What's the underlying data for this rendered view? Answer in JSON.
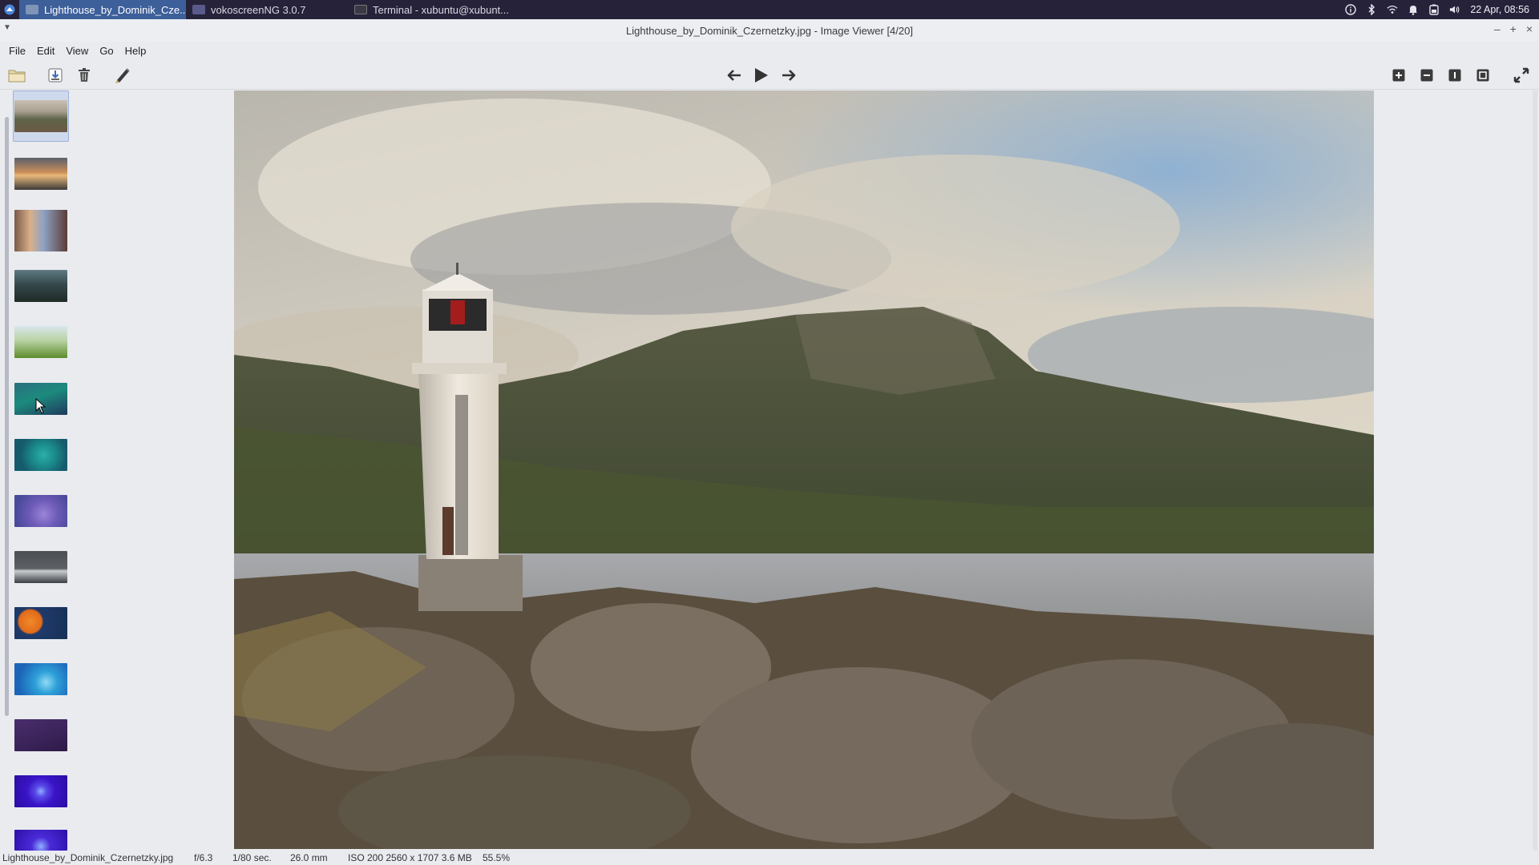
{
  "taskbar": {
    "tasks": [
      {
        "label": "Lighthouse_by_Dominik_Cze...",
        "active": true
      },
      {
        "label": "vokoscreenNG 3.0.7",
        "active": false
      },
      {
        "label": "Terminal - xubuntu@xubunt...",
        "active": false
      }
    ],
    "clock": "22 Apr, 08:56",
    "tray_icons": [
      "info-icon",
      "bluetooth-icon",
      "wifi-icon",
      "bell-icon",
      "battery-icon",
      "volume-icon"
    ]
  },
  "window": {
    "title": "Lighthouse_by_Dominik_Czernetzky.jpg - Image Viewer [4/20]"
  },
  "menubar": {
    "items": [
      "File",
      "Edit",
      "View",
      "Go",
      "Help"
    ]
  },
  "toolbar": {
    "left_icons": [
      "folder-open-icon",
      "save-icon",
      "delete-icon",
      "edit-icon"
    ],
    "nav_icons": [
      "previous-icon",
      "slideshow-play-icon",
      "next-icon"
    ],
    "right_icons": [
      "zoom-in-icon",
      "zoom-out-icon",
      "zoom-original-icon",
      "zoom-fit-icon",
      "fullscreen-icon"
    ]
  },
  "thumbnails": [
    {
      "name": "lighthouse",
      "selected": true
    },
    {
      "name": "sunset-road",
      "selected": false
    },
    {
      "name": "city-cat",
      "selected": false
    },
    {
      "name": "dark-hills",
      "selected": false
    },
    {
      "name": "grass",
      "selected": false
    },
    {
      "name": "teal-wave",
      "selected": false
    },
    {
      "name": "teal-circle",
      "selected": false
    },
    {
      "name": "violet-arc",
      "selected": false
    },
    {
      "name": "grey-mountain",
      "selected": false
    },
    {
      "name": "orange-planet",
      "selected": false
    },
    {
      "name": "blue-arc",
      "selected": false
    },
    {
      "name": "dark-purple",
      "selected": false
    },
    {
      "name": "indigo-blobs",
      "selected": false
    },
    {
      "name": "indigo-partial",
      "selected": false
    }
  ],
  "statusbar": {
    "filename": "Lighthouse_by_Dominik_Czernetzky.jpg",
    "aperture": "f/6.3",
    "exposure": "1/80 sec.",
    "focal_length": "26.0 mm",
    "details": "ISO 200 2560 x 1707 3.6 MB",
    "zoom": "55.5%"
  },
  "colors": {
    "taskbar_bg": "#26223a",
    "active_task": "#3d5f9a",
    "window_bg": "#e9ebef",
    "selection": "#cfd9ee"
  }
}
